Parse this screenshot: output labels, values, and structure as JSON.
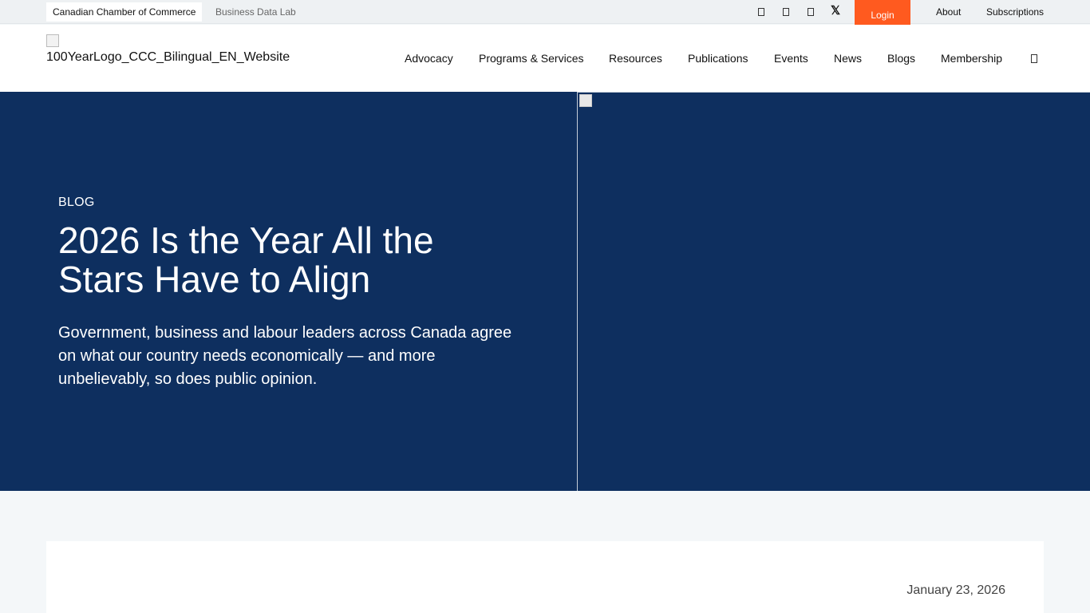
{
  "topbar": {
    "tabs": [
      {
        "label": "Canadian Chamber of Commerce"
      },
      {
        "label": "Business Data Lab"
      }
    ],
    "social_icons": [
      "social-icon",
      "social-icon",
      "social-icon",
      "x-twitter-icon"
    ],
    "x_glyph": "𝕏",
    "login_label": "Login",
    "links": [
      {
        "label": "About"
      },
      {
        "label": "Subscriptions"
      }
    ]
  },
  "header": {
    "logo_alt": "100YearLogo_CCC_Bilingual_EN_Website",
    "nav": [
      {
        "label": "Advocacy"
      },
      {
        "label": "Programs & Services"
      },
      {
        "label": "Resources"
      },
      {
        "label": "Publications"
      },
      {
        "label": "Events"
      },
      {
        "label": "News"
      },
      {
        "label": "Blogs"
      },
      {
        "label": "Membership"
      }
    ],
    "search_icon": "search-icon"
  },
  "hero": {
    "eyebrow": "BLOG",
    "title": "2026 Is the Year All the Stars Have to Align",
    "subtitle": "Government, business and labour leaders across Canada agree on what our country needs economically — and more unbelievably, so does public opinion."
  },
  "article": {
    "date": "January 23, 2026"
  },
  "colors": {
    "hero_bg": "#0e2f5f",
    "login_bg": "#ff5a1f",
    "page_bg": "#f4f7f9"
  }
}
